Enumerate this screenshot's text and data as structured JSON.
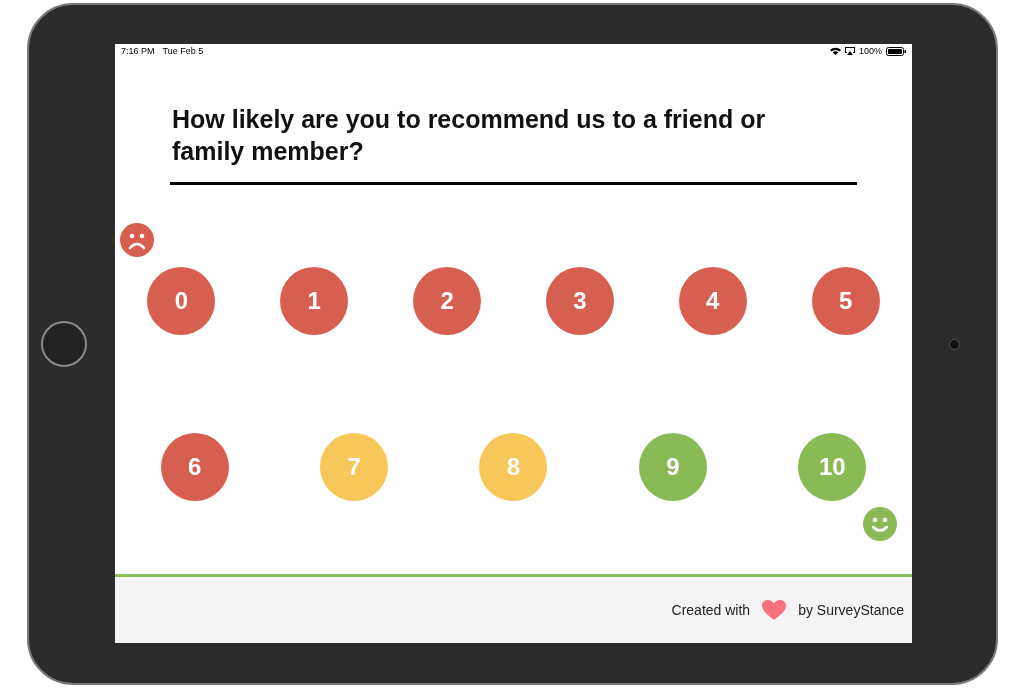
{
  "status_bar": {
    "time": "7:16 PM",
    "date": "Tue Feb 5",
    "battery": "100%"
  },
  "question": "How likely are you to recommend us to a friend or family member?",
  "low_face": {
    "kind": "sad",
    "color": "#d65f50"
  },
  "score_rows": [
    {
      "options": [
        {
          "label": "0",
          "color": "#d65f50"
        },
        {
          "label": "1",
          "color": "#d65f50"
        },
        {
          "label": "2",
          "color": "#d65f50"
        },
        {
          "label": "3",
          "color": "#d65f50"
        },
        {
          "label": "4",
          "color": "#d65f50"
        },
        {
          "label": "5",
          "color": "#d65f50"
        }
      ]
    },
    {
      "options": [
        {
          "label": "6",
          "color": "#d65f50"
        },
        {
          "label": "7",
          "color": "#f8c75a"
        },
        {
          "label": "8",
          "color": "#f8c75a"
        },
        {
          "label": "9",
          "color": "#89ba55"
        },
        {
          "label": "10",
          "color": "#89ba55"
        }
      ]
    }
  ],
  "high_face": {
    "kind": "happy",
    "color": "#89ba55"
  },
  "footer": {
    "prefix": "Created with",
    "suffix": "by SurveyStance"
  }
}
